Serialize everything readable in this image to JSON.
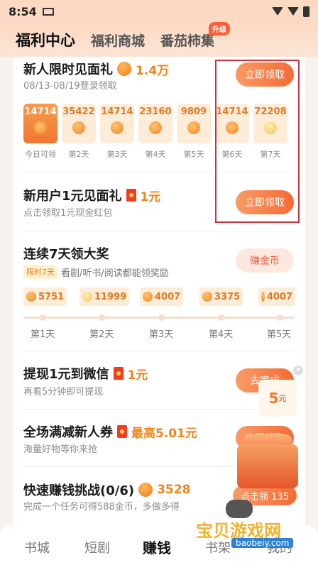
{
  "status_bar": {
    "time": "8:54"
  },
  "header": {
    "tabs": [
      {
        "label": "福利中心",
        "active": true
      },
      {
        "label": "福利商城",
        "active": false
      },
      {
        "label": "番茄柿集",
        "active": false,
        "badge": "升级"
      }
    ]
  },
  "newcomer_gift": {
    "title": "新人限时见面礼",
    "amount": "1.4万",
    "date_range": "08/13-08/19登录领取",
    "button": "立即领取",
    "days": [
      {
        "value": "14714",
        "label": "今日可领"
      },
      {
        "value": "35422",
        "label": "第2天"
      },
      {
        "value": "14714",
        "label": "第3天"
      },
      {
        "value": "23160",
        "label": "第4天"
      },
      {
        "value": "9809",
        "label": "第5天"
      },
      {
        "value": "14714",
        "label": "第6天"
      },
      {
        "value": "72208",
        "label": "第7天"
      }
    ]
  },
  "new_user_gift": {
    "title": "新用户1元见面礼",
    "amount": "1元",
    "subtitle": "点击领取1元现金红包",
    "button": "立即领取"
  },
  "seven_day": {
    "title": "连续7天领大奖",
    "tag": "限时7天",
    "subtitle": "看剧/听书/阅读都能领奖励",
    "button": "赚金币",
    "rewards": [
      "5751",
      "11999",
      "4007",
      "3375",
      "4007"
    ],
    "day_labels": [
      "第1天",
      "第2天",
      "第3天",
      "第4天",
      "第5天"
    ]
  },
  "withdraw": {
    "title": "提现1元到微信",
    "amount": "1元",
    "subtitle": "再看5分钟即可提现",
    "button": "去完成"
  },
  "coupon": {
    "title": "全场满减新人券",
    "amount": "最高5.01元",
    "subtitle": "海量好物等你来抢",
    "button": "立即领取"
  },
  "quick_earn": {
    "title": "快速赚钱挑战(0/6)",
    "amount": "3528",
    "subtitle": "完成一个任务可得588金币，多做多得",
    "button": "点击领 135"
  },
  "floating_reward": {
    "value": "5",
    "unit": "元"
  },
  "bottom_nav": {
    "items": [
      {
        "label": "书城",
        "active": false
      },
      {
        "label": "短剧",
        "active": false
      },
      {
        "label": "赚钱",
        "active": true
      },
      {
        "label": "书架",
        "active": false
      },
      {
        "label": "我的",
        "active": false
      }
    ]
  },
  "watermark": {
    "name": "宝贝游戏网",
    "url": "baobeiy.com"
  }
}
